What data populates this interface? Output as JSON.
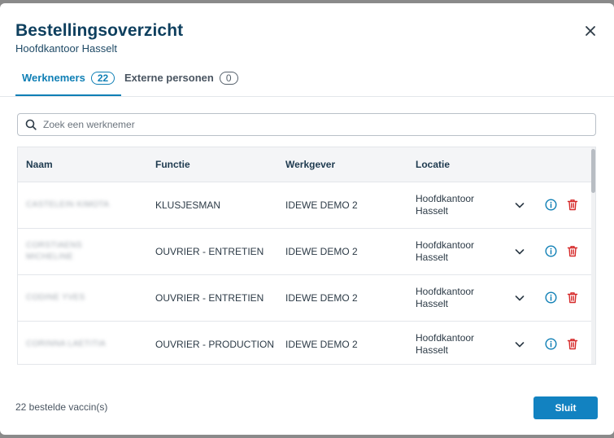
{
  "modal": {
    "title": "Bestellingsoverzicht",
    "subtitle": "Hoofdkantoor Hasselt"
  },
  "tabs": [
    {
      "label": "Werknemers",
      "count": "22",
      "active": true
    },
    {
      "label": "Externe personen",
      "count": "0",
      "active": false
    }
  ],
  "search": {
    "placeholder": "Zoek een werknemer",
    "value": ""
  },
  "table": {
    "headers": [
      "Naam",
      "Functie",
      "Werkgever",
      "Locatie"
    ],
    "rows": [
      {
        "name_lines": [
          "CASTELEIN KIMOTA"
        ],
        "functie": "KLUSJESMAN",
        "werkgever": "IDEWE DEMO 2",
        "locatie_lines": [
          "Hoofdkantoor",
          "Hasselt"
        ]
      },
      {
        "name_lines": [
          "CORSTIAENS",
          "MICHELINE"
        ],
        "functie": "OUVRIER - ENTRETIEN",
        "werkgever": "IDEWE DEMO 2",
        "locatie_lines": [
          "Hoofdkantoor",
          "Hasselt"
        ]
      },
      {
        "name_lines": [
          "CODINE YVES"
        ],
        "functie": "OUVRIER - ENTRETIEN",
        "werkgever": "IDEWE DEMO 2",
        "locatie_lines": [
          "Hoofdkantoor",
          "Hasselt"
        ]
      },
      {
        "name_lines": [
          "CORINNA LAETITIA"
        ],
        "functie": "OUVRIER - PRODUCTION",
        "werkgever": "IDEWE DEMO 2",
        "locatie_lines": [
          "Hoofdkantoor",
          "Hasselt"
        ]
      }
    ]
  },
  "footer": {
    "summary": "22 bestelde vaccin(s)",
    "close_label": "Sluit"
  },
  "colors": {
    "title": "#0e3f5e",
    "accent": "#1282c1",
    "info_icon": "#0f7fb5",
    "delete_icon": "#d62a2a"
  },
  "icons": {
    "close": "close-icon",
    "search": "search-icon",
    "expand": "chevron-down-icon",
    "info": "info-icon",
    "delete": "trash-icon"
  }
}
